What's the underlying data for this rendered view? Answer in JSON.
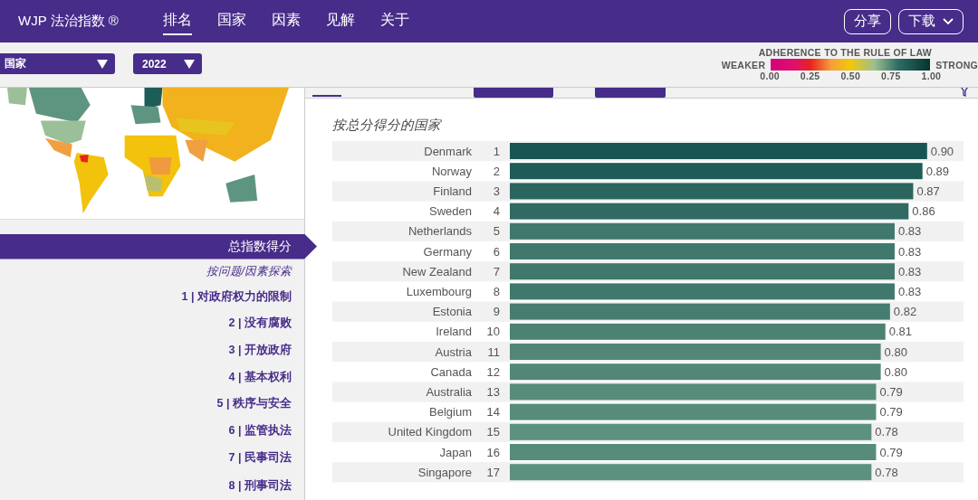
{
  "header": {
    "title": "WJP 法治指数 ®",
    "nav": [
      {
        "label": "排名",
        "selected": true
      },
      {
        "label": "国家",
        "selected": false
      },
      {
        "label": "因素",
        "selected": false
      },
      {
        "label": "见解",
        "selected": false
      },
      {
        "label": "关于",
        "selected": false
      }
    ],
    "buttons": [
      {
        "label": "分享",
        "dropdown": false
      },
      {
        "label": "下载",
        "dropdown": true
      }
    ]
  },
  "filters": {
    "view": "国家",
    "year": "2022"
  },
  "legend": {
    "title": "ADHERENCE TO THE RULE OF LAW",
    "low": "WEAKER",
    "high": "STRONG",
    "ticks": [
      "0.00",
      "0.25",
      "0.50",
      "0.75",
      "1.00"
    ]
  },
  "sidebar": [
    {
      "kind": "main",
      "label": "总指数得分",
      "selected": true
    },
    {
      "kind": "heading",
      "label": "按问题/因素探索"
    },
    {
      "kind": "item",
      "label": "1 | 对政府权力的限制",
      "selected": false
    },
    {
      "kind": "item",
      "label": "2 | 没有腐败",
      "selected": false
    },
    {
      "kind": "item",
      "label": "3 | 开放政府",
      "selected": false
    },
    {
      "kind": "item",
      "label": "4 | 基本权利",
      "selected": false
    },
    {
      "kind": "item",
      "label": "5 | 秩序与安全",
      "selected": false
    },
    {
      "kind": "item",
      "label": "6 | 监管执法",
      "selected": false
    },
    {
      "kind": "item",
      "label": "7 | 民事司法",
      "selected": false
    },
    {
      "kind": "item",
      "label": "8 | 刑事司法",
      "selected": false
    }
  ],
  "chart": {
    "ranks": [
      "1",
      "2",
      "3",
      "4",
      "5",
      "6",
      "7",
      "8",
      "9",
      "10",
      "11",
      "12",
      "13",
      "14",
      "15",
      "16",
      "17"
    ],
    "chart_data": {
      "type": "bar",
      "orientation": "horizontal",
      "title": "按总分得分的国家",
      "value_labels": [
        "0.90",
        "0.89",
        "0.87",
        "0.86",
        "0.83",
        "0.83",
        "0.83",
        "0.83",
        "0.82",
        "0.81",
        "0.80",
        "0.80",
        "0.79",
        "0.79",
        "0.78",
        "0.79",
        "0.78"
      ],
      "categories": [
        "Denmark",
        "Norway",
        "Finland",
        "Sweden",
        "Netherlands",
        "Germany",
        "New Zealand",
        "Luxembourg",
        "Estonia",
        "Ireland",
        "Austria",
        "Canada",
        "Australia",
        "Belgium",
        "United Kingdom",
        "Japan",
        "Singapore"
      ],
      "values": [
        0.9,
        0.89,
        0.87,
        0.86,
        0.83,
        0.83,
        0.83,
        0.83,
        0.82,
        0.81,
        0.8,
        0.8,
        0.79,
        0.79,
        0.78,
        0.79,
        0.78
      ]
    }
  }
}
